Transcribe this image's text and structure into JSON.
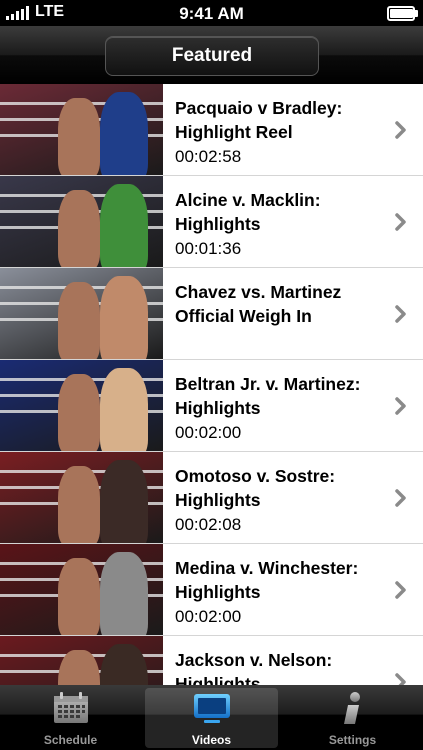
{
  "status_bar": {
    "carrier": "LTE",
    "time": "9:41 AM",
    "signal_bars": 5,
    "battery_level": 0.95
  },
  "nav": {
    "title": "Featured"
  },
  "videos": [
    {
      "title_line1": "Pacquaio v Bradley:",
      "title_line2": "Highlight Reel",
      "duration": "00:02:58",
      "thumb_bg": "#6b2a36",
      "thumb_accent": "#1f3e8a"
    },
    {
      "title_line1": "Alcine v. Macklin:",
      "title_line2": "Highlights",
      "duration": "00:01:36",
      "thumb_bg": "#39384a",
      "thumb_accent": "#3f8f3a"
    },
    {
      "title_line1": "Chavez vs. Martinez",
      "title_line2": "Official Weigh In",
      "duration": "",
      "thumb_bg": "#8a8f9a",
      "thumb_accent": "#c08a6a"
    },
    {
      "title_line1": "Beltran Jr. v. Martinez:",
      "title_line2": "Highlights",
      "duration": "00:02:00",
      "thumb_bg": "#1a2b73",
      "thumb_accent": "#d7b08a"
    },
    {
      "title_line1": "Omotoso v. Sostre:",
      "title_line2": "Highlights",
      "duration": "00:02:08",
      "thumb_bg": "#7a1e22",
      "thumb_accent": "#3b2a26"
    },
    {
      "title_line1": "Medina v. Winchester:",
      "title_line2": "Highlights",
      "duration": "00:02:00",
      "thumb_bg": "#5a1418",
      "thumb_accent": "#8a8a8a"
    },
    {
      "title_line1": "Jackson v. Nelson:",
      "title_line2": "Highlights",
      "duration": "",
      "thumb_bg": "#6b1a1f",
      "thumb_accent": "#3a2a24"
    }
  ],
  "tabs": [
    {
      "label": "Schedule",
      "icon": "calendar-icon",
      "selected": false
    },
    {
      "label": "Videos",
      "icon": "tv-icon",
      "selected": true
    },
    {
      "label": "Settings",
      "icon": "info-icon",
      "selected": false
    }
  ],
  "colors": {
    "accent": "#1e8fe0",
    "chevron": "#8a8a8a"
  }
}
